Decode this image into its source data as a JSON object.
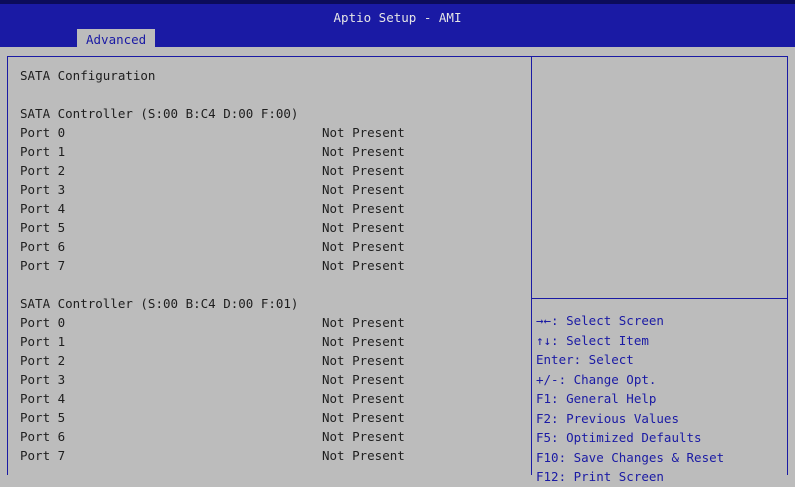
{
  "header": {
    "title": "Aptio Setup - AMI",
    "tabs": [
      {
        "label": "Advanced"
      }
    ]
  },
  "main": {
    "title": "SATA Configuration",
    "controllers": [
      {
        "label": "SATA Controller (S:00 B:C4 D:00 F:00)",
        "ports": [
          {
            "label": "Port 0",
            "value": "Not Present"
          },
          {
            "label": "Port 1",
            "value": "Not Present"
          },
          {
            "label": "Port 2",
            "value": "Not Present"
          },
          {
            "label": "Port 3",
            "value": "Not Present"
          },
          {
            "label": "Port 4",
            "value": "Not Present"
          },
          {
            "label": "Port 5",
            "value": "Not Present"
          },
          {
            "label": "Port 6",
            "value": "Not Present"
          },
          {
            "label": "Port 7",
            "value": "Not Present"
          }
        ]
      },
      {
        "label": "SATA Controller (S:00 B:C4 D:00 F:01)",
        "ports": [
          {
            "label": "Port 0",
            "value": "Not Present"
          },
          {
            "label": "Port 1",
            "value": "Not Present"
          },
          {
            "label": "Port 2",
            "value": "Not Present"
          },
          {
            "label": "Port 3",
            "value": "Not Present"
          },
          {
            "label": "Port 4",
            "value": "Not Present"
          },
          {
            "label": "Port 5",
            "value": "Not Present"
          },
          {
            "label": "Port 6",
            "value": "Not Present"
          },
          {
            "label": "Port 7",
            "value": "Not Present"
          }
        ]
      }
    ]
  },
  "help": [
    "→←: Select Screen",
    "↑↓: Select Item",
    "Enter: Select",
    "+/-: Change Opt.",
    "F1: General Help",
    "F2: Previous Values",
    "F5: Optimized Defaults",
    "F10: Save Changes & Reset",
    "F12: Print Screen"
  ],
  "colors": {
    "header_bg": "#1a1aa4",
    "body_bg": "#bcbcbc",
    "help_text": "#1a1aa4",
    "text": "#1e1e1e"
  }
}
